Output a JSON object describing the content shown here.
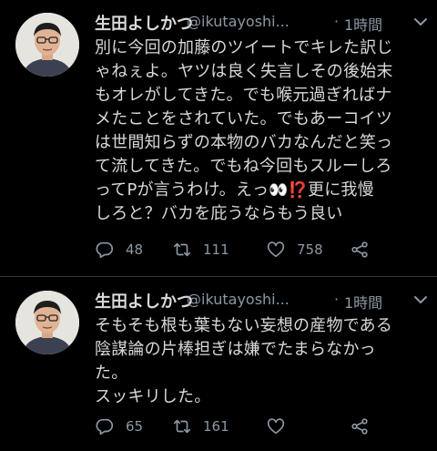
{
  "tweets": [
    {
      "name": "生田よしかつ",
      "handle": "@ikutayoshi...",
      "separator": "·",
      "time": "1時間",
      "lines": [
        "別に今回の加藤のツイートでキレた訳じ",
        "ゃねぇよ。ヤツは良く失言しその後始末",
        "もオレがしてきた。でも喉元過ぎればナ",
        "メたことをされていた。でもあーコイツ",
        "は世間知らずの本物のバカなんだと笑っ",
        "て流してきた。でもね今回もスルーしろ",
        "ってPが言うわけ。えっ",
        "更に我慢",
        "しろと？バカを庇うならもう良い"
      ],
      "emoji": [
        "👀",
        "⁉️"
      ],
      "counts": {
        "reply": "48",
        "retweet": "111",
        "like": "758"
      }
    },
    {
      "name": "生田よしかつ",
      "handle": "@ikutayoshi...",
      "separator": "·",
      "time": "1時間",
      "lines": [
        "そもそも根も葉もない妄想の産物である",
        "陰謀論の片棒担ぎは嫌でたまらなかっ",
        "た。",
        "スッキリした。"
      ],
      "counts": {
        "reply": "65",
        "retweet": "161",
        "like": ""
      }
    }
  ],
  "colors": {
    "background": "#000000",
    "text": "#d9d9d9",
    "muted": "#8b98a5",
    "divider": "#2f3336"
  },
  "icons": [
    "avatar",
    "chevron-down-icon",
    "reply-icon",
    "retweet-icon",
    "like-icon",
    "share-icon"
  ]
}
